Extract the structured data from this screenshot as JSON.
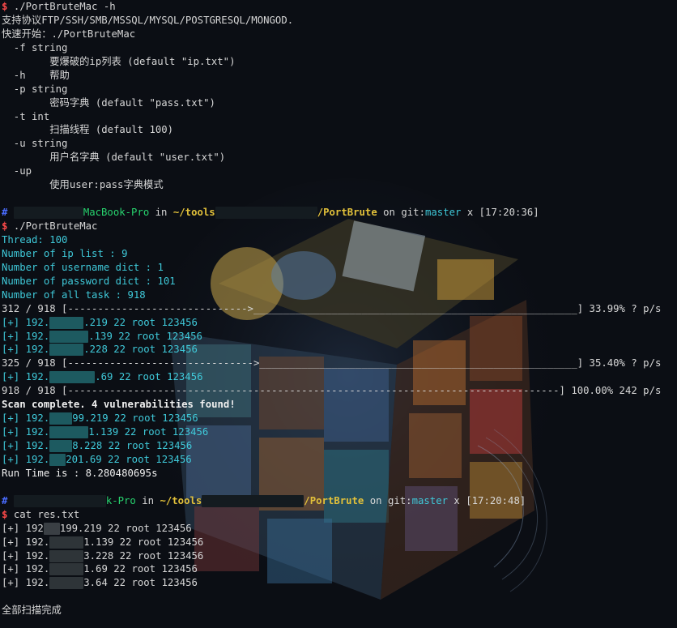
{
  "colors": {
    "background": "#0b0e14",
    "text": "#d7d7d7",
    "prompt_dollar": "#ff4a4a",
    "cyan": "#3fc9d9",
    "host_green": "#27d36e",
    "path_yellow": "#e2c13a",
    "hash_blue": "#4a6cff"
  },
  "help": {
    "cmd": "./PortBruteMac -h",
    "support": "支持协议FTP/SSH/SMB/MSSQL/MYSQL/POSTGRESQL/MONGOD.",
    "quickstart": "快速开始：./PortBruteMac",
    "opt_f": "  -f string",
    "opt_f_desc": "        要爆破的ip列表 (default \"ip.txt\")",
    "opt_h": "  -h    帮助",
    "opt_p": "  -p string",
    "opt_p_desc": "        密码字典 (default \"pass.txt\")",
    "opt_t": "  -t int",
    "opt_t_desc": "        扫描线程 (default 100)",
    "opt_u": "  -u string",
    "opt_u_desc": "        用户名字典 (default \"user.txt\")",
    "opt_up": "  -up",
    "opt_up_desc": "        使用user:pass字典模式"
  },
  "prompt1": {
    "hash": "#",
    "host": "MacBook-Pro",
    "in": " in ",
    "path": "~/tools",
    "path_end": "/PortBrute",
    "on": " on ",
    "git": "git:",
    "branch": "master",
    "dirty": " x ",
    "time": "[17:20:36]"
  },
  "run": {
    "cmd": "./PortBruteMac",
    "thread": "Thread: 100",
    "ip_list": "Number of ip list : 9",
    "user_dict": "Number of username dict : 1",
    "pass_dict": "Number of password dict : 101",
    "all_task": "Number of all task : 918",
    "progress1_count": "312 / 918 [",
    "progress1_bar": "------------------------------>______________________________________________________",
    "progress1_end": "] 33.99% ? p/s",
    "hit1_a": "[+] 192.",
    "hit1_b": ".219 22 root 123456",
    "hit2_a": "[+] 192.",
    "hit2_b": ".139 22 root 123456",
    "hit3_a": "[+] 192.",
    "hit3_b": ".228 22 root 123456",
    "progress2_count": "325 / 918 [",
    "progress2_bar": "------------------------------->_____________________________________________________",
    "progress2_end": "] 35.40% ? p/s",
    "hit4_a": "[+] 192.",
    "hit4_b": ".69 22 root 123456",
    "progress3_count": "918 / 918 [",
    "progress3_bar": "----------------------------------------------------------------------------------",
    "progress3_end": "] 100.00% 242 p/s",
    "complete": "Scan complete. 4 vulnerabilities found!",
    "sum1_a": "[+] 192.",
    "sum1_b": "99.219 22 root 123456",
    "sum2_a": "[+] 192.",
    "sum2_b": "1.139 22 root 123456",
    "sum3_a": "[+] 192.",
    "sum3_b": "8.228 22 root 123456",
    "sum4_a": "[+] 192.",
    "sum4_b": "201.69 22 root 123456",
    "runtime": "Run Time is : 8.280480695s"
  },
  "prompt2": {
    "hash": "#",
    "host": "k-Pro",
    "in": " in ",
    "path": "~/tools",
    "path_end": "/PortBrute",
    "on": " on ",
    "git": "git:",
    "branch": "master",
    "dirty": " x ",
    "time": "[17:20:48]"
  },
  "cat": {
    "cmd": "cat res.txt",
    "r1_a": "[+] 192",
    "r1_b": "199.219 22 root 123456",
    "r2_a": "[+] 192.",
    "r2_b": "1.139 22 root 123456",
    "r3_a": "[+] 192.",
    "r3_b": "3.228 22 root 123456",
    "r4_a": "[+] 192.",
    "r4_b": "1.69 22 root 123456",
    "r5_a": "[+] 192.",
    "r5_b": "3.64 22 root 123456"
  },
  "footer": "全部扫描完成",
  "prompt_symbol": "$ "
}
